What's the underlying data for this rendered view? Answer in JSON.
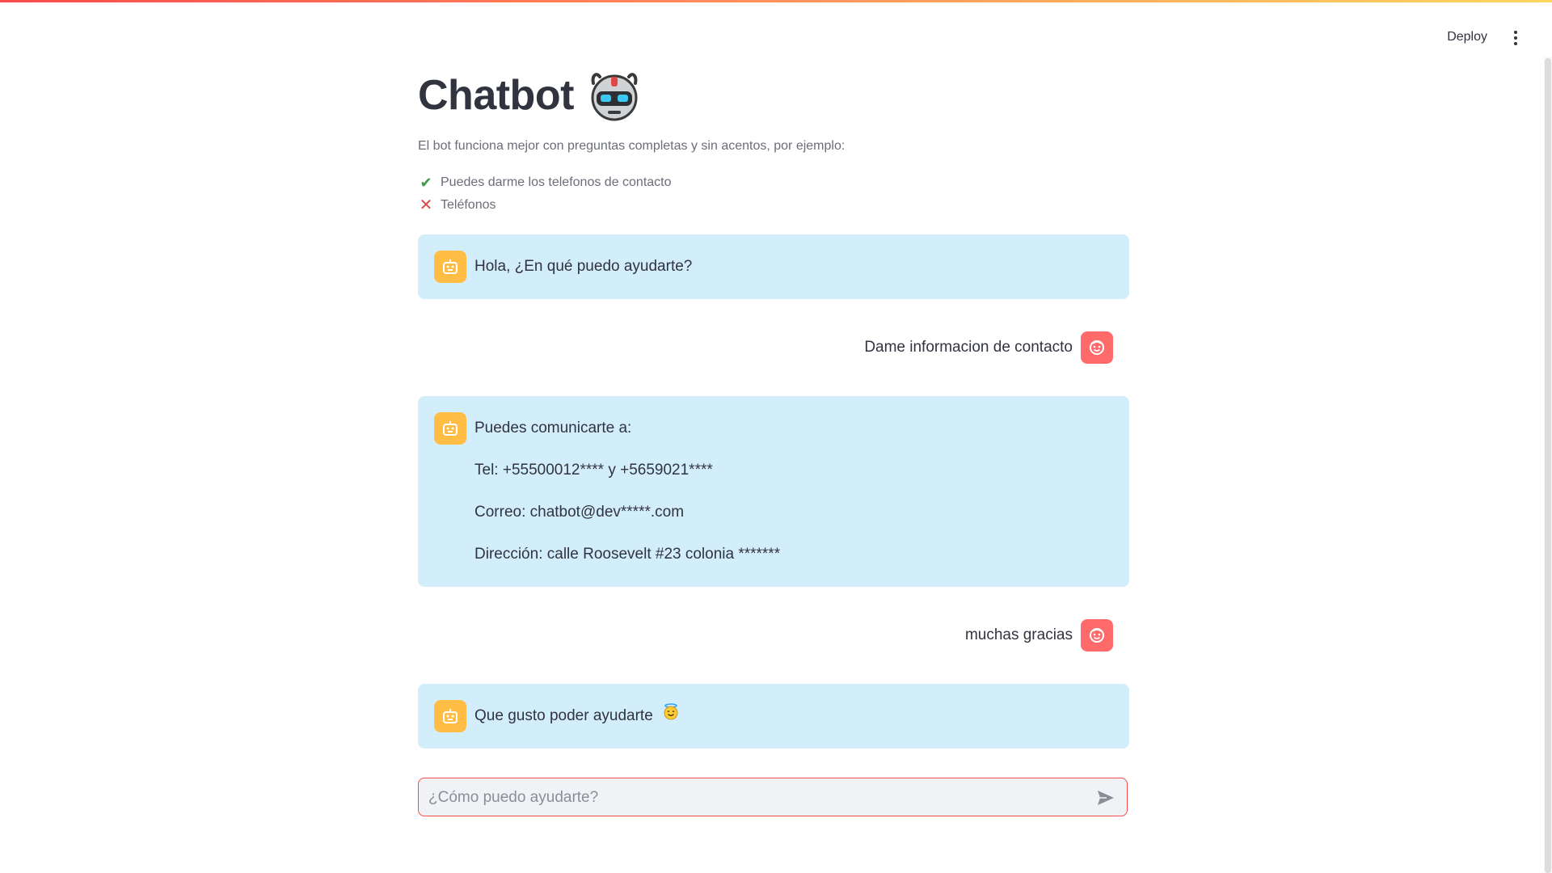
{
  "header": {
    "deploy_label": "Deploy",
    "menu_icon": "more-vertical-icon"
  },
  "page": {
    "title": "Chatbot",
    "title_emoji": "robot-face-icon",
    "caption": "El bot funciona mejor con preguntas completas y sin acentos, por ejemplo:",
    "examples": [
      {
        "icon": "check-icon",
        "text": "Puedes darme los telefonos de contacto"
      },
      {
        "icon": "cross-icon",
        "text": "Teléfonos"
      }
    ]
  },
  "messages": [
    {
      "role": "assistant",
      "avatar": "robot-icon",
      "lines": [
        "Hola, ¿En qué puedo ayudarte?"
      ]
    },
    {
      "role": "user",
      "avatar": "smiley-icon",
      "lines": [
        "Dame informacion de contacto"
      ]
    },
    {
      "role": "assistant",
      "avatar": "robot-icon",
      "lines": [
        "Puedes comunicarte a:",
        "Tel: +55500012**** y +5659021****",
        "Correo: chatbot@dev*****.com",
        "Dirección: calle Roosevelt #23 colonia *******"
      ]
    },
    {
      "role": "user",
      "avatar": "smiley-icon",
      "lines": [
        "muchas gracias"
      ]
    },
    {
      "role": "assistant",
      "avatar": "robot-icon",
      "lines": [
        "Que gusto poder ayudarte"
      ],
      "emoji": "smiling-halo-face-icon"
    }
  ],
  "chat_input": {
    "placeholder": "¿Cómo puedo ayudarte?",
    "value": "",
    "send_icon": "send-icon"
  },
  "colors": {
    "accent": "#ff4b4b",
    "bot_bubble": "#d3eefb",
    "bot_avatar": "#ffbd45",
    "user_avatar": "#ff6b6b",
    "text": "#31333f"
  }
}
